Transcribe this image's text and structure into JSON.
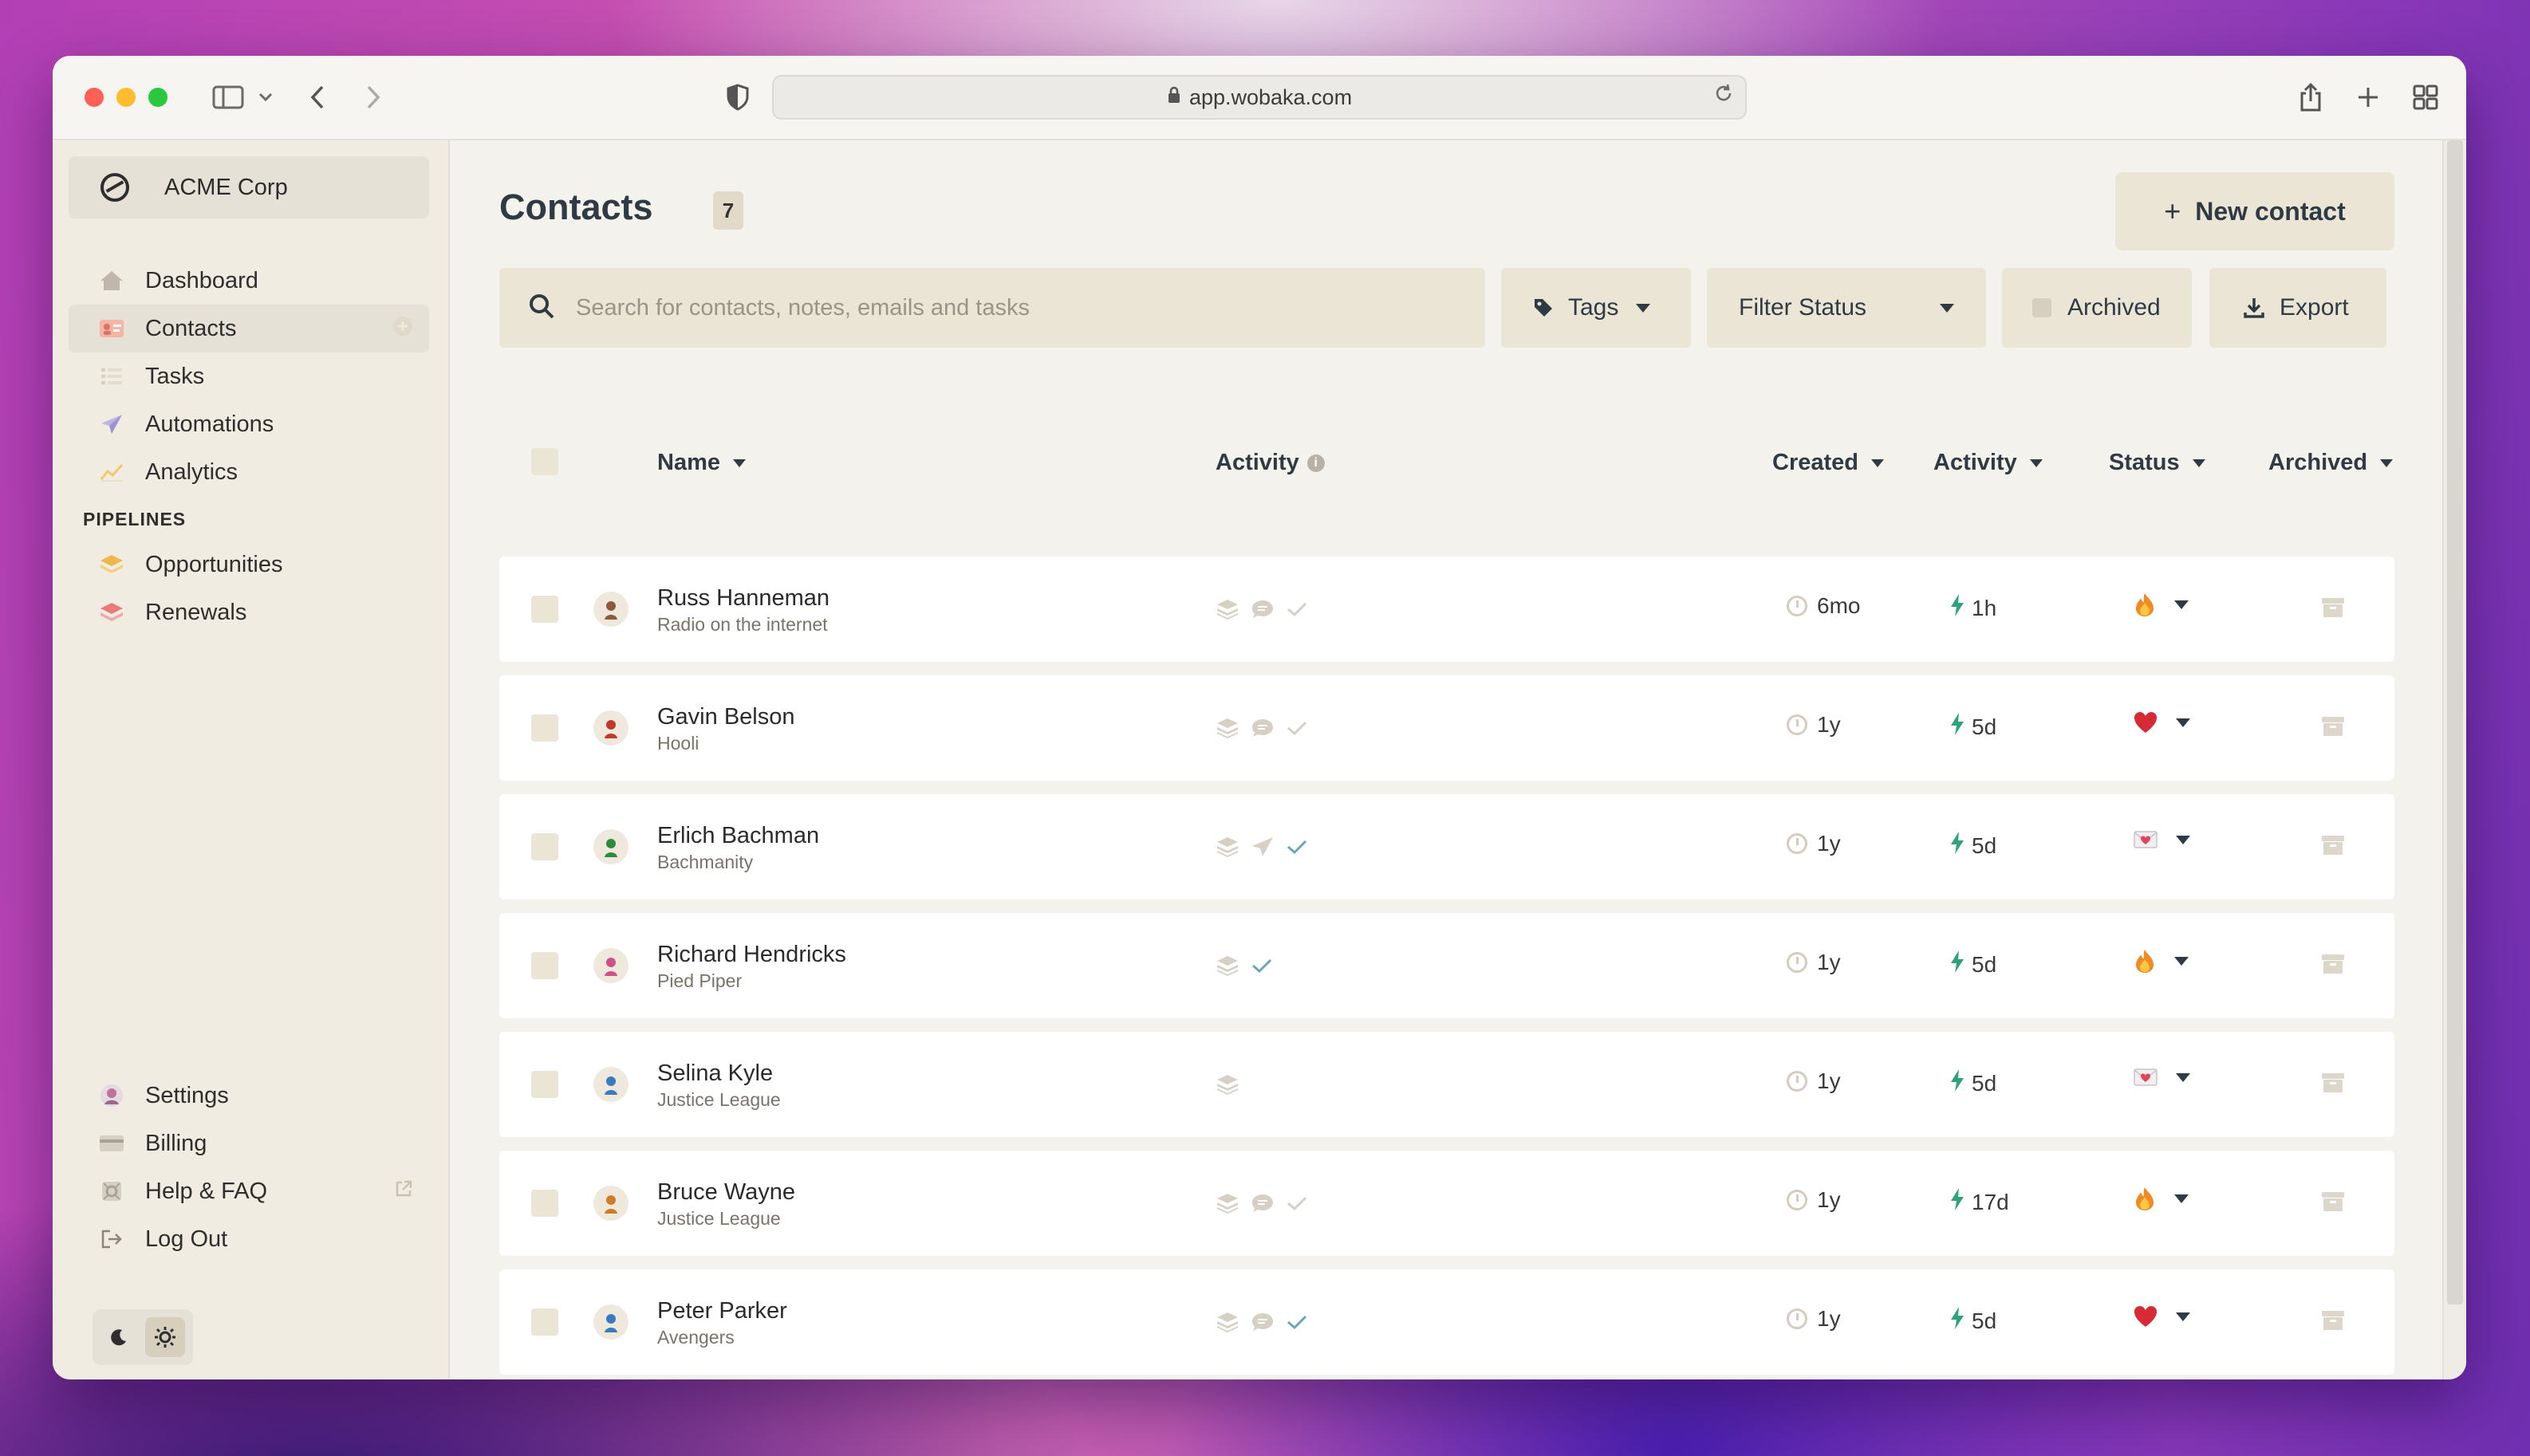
{
  "browser": {
    "url": "app.wobaka.com"
  },
  "sidebar": {
    "org_name": "ACME Corp",
    "nav": [
      {
        "label": "Dashboard",
        "icon": "home-icon"
      },
      {
        "label": "Contacts",
        "icon": "contacts-card-icon",
        "active": true
      },
      {
        "label": "Tasks",
        "icon": "tasks-list-icon"
      },
      {
        "label": "Automations",
        "icon": "paper-plane-icon"
      },
      {
        "label": "Analytics",
        "icon": "chart-icon"
      }
    ],
    "pipelines_title": "PIPELINES",
    "pipelines": [
      {
        "label": "Opportunities",
        "icon": "layers-icon",
        "color": "#f0b64a"
      },
      {
        "label": "Renewals",
        "icon": "layers-icon",
        "color": "#e87a7a"
      }
    ],
    "bottom": [
      {
        "label": "Settings",
        "icon": "avatar-icon"
      },
      {
        "label": "Billing",
        "icon": "credit-card-icon"
      },
      {
        "label": "Help & FAQ",
        "icon": "help-icon",
        "external": true
      },
      {
        "label": "Log Out",
        "icon": "logout-icon"
      }
    ]
  },
  "page": {
    "title": "Contacts",
    "count": "7",
    "new_contact_label": "New contact",
    "search_placeholder": "Search for contacts, notes, emails and tasks",
    "filters": {
      "tags": "Tags",
      "status": "Filter Status",
      "archived": "Archived",
      "export": "Export"
    }
  },
  "table": {
    "headers": {
      "name": "Name",
      "activity_icons": "Activity",
      "created": "Created",
      "activity": "Activity",
      "status": "Status",
      "archived": "Archived"
    },
    "rows": [
      {
        "name": "Russ Hanneman",
        "company": "Radio on the internet",
        "created": "6mo",
        "activity": "1h",
        "status": "fire",
        "acts": [
          "stack",
          "chat",
          "check-muted"
        ],
        "avatar": "#8a5a3a"
      },
      {
        "name": "Gavin Belson",
        "company": "Hooli",
        "created": "1y",
        "activity": "5d",
        "status": "heart",
        "acts": [
          "stack",
          "chat",
          "check-muted"
        ],
        "avatar": "#c0392b"
      },
      {
        "name": "Erlich Bachman",
        "company": "Bachmanity",
        "created": "1y",
        "activity": "5d",
        "status": "love-letter",
        "acts": [
          "stack",
          "send",
          "check"
        ],
        "avatar": "#2e8b3a"
      },
      {
        "name": "Richard Hendricks",
        "company": "Pied Piper",
        "created": "1y",
        "activity": "5d",
        "status": "fire",
        "acts": [
          "stack",
          "check"
        ],
        "avatar": "#d0508a"
      },
      {
        "name": "Selina Kyle",
        "company": "Justice League",
        "created": "1y",
        "activity": "5d",
        "status": "love-letter",
        "acts": [
          "stack"
        ],
        "avatar": "#3a7ac0"
      },
      {
        "name": "Bruce Wayne",
        "company": "Justice League",
        "created": "1y",
        "activity": "17d",
        "status": "fire",
        "acts": [
          "stack",
          "chat",
          "check-muted"
        ],
        "avatar": "#d07a2a"
      },
      {
        "name": "Peter Parker",
        "company": "Avengers",
        "created": "1y",
        "activity": "5d",
        "status": "heart",
        "acts": [
          "stack",
          "chat",
          "check"
        ],
        "avatar": "#3a7ac0"
      }
    ]
  }
}
